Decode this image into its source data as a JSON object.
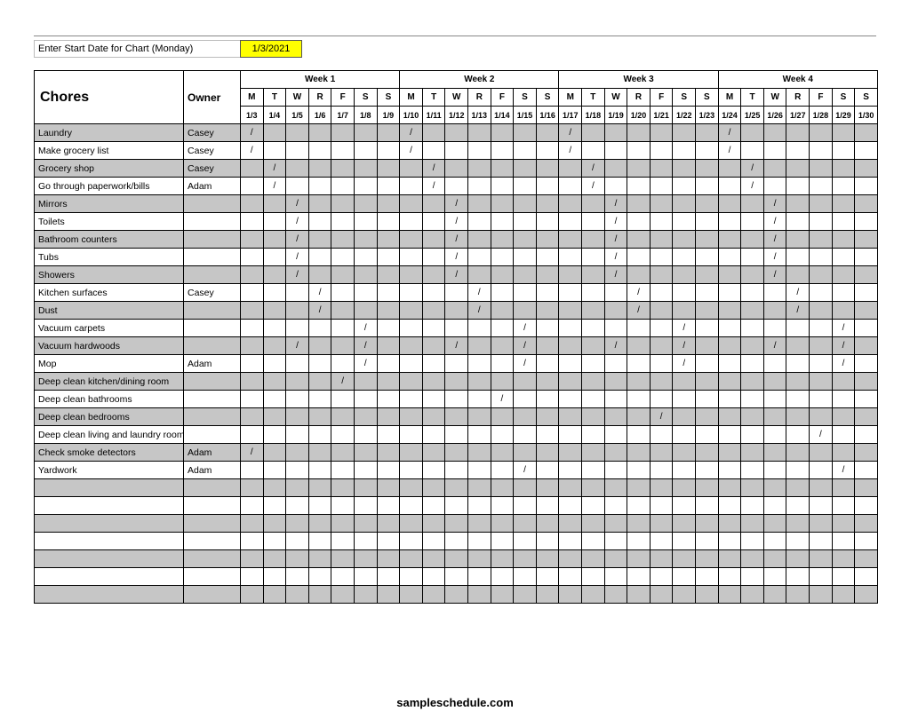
{
  "start_date_label": "Enter Start Date for Chart (Monday)",
  "start_date": "1/3/2021",
  "header": {
    "chores": "Chores",
    "owner": "Owner",
    "weeks": [
      "Week 1",
      "Week 2",
      "Week 3",
      "Week 4"
    ],
    "days": [
      "M",
      "T",
      "W",
      "R",
      "F",
      "S",
      "S"
    ],
    "dates": [
      "1/3",
      "1/4",
      "1/5",
      "1/6",
      "1/7",
      "1/8",
      "1/9",
      "1/10",
      "1/11",
      "1/12",
      "1/13",
      "1/14",
      "1/15",
      "1/16",
      "1/17",
      "1/18",
      "1/19",
      "1/20",
      "1/21",
      "1/22",
      "1/23",
      "1/24",
      "1/25",
      "1/26",
      "1/27",
      "1/28",
      "1/29",
      "1/30"
    ]
  },
  "rows": [
    {
      "chore": "Laundry",
      "owner": "Casey",
      "marks": [
        0,
        7,
        14,
        21
      ]
    },
    {
      "chore": "Make grocery list",
      "owner": "Casey",
      "marks": [
        0,
        7,
        14,
        21
      ]
    },
    {
      "chore": "Grocery shop",
      "owner": "Casey",
      "marks": [
        1,
        8,
        15,
        22
      ]
    },
    {
      "chore": "Go through paperwork/bills",
      "owner": "Adam",
      "marks": [
        1,
        8,
        15,
        22
      ]
    },
    {
      "chore": "Mirrors",
      "owner": "",
      "marks": [
        2,
        9,
        16,
        23
      ]
    },
    {
      "chore": "Toilets",
      "owner": "",
      "marks": [
        2,
        9,
        16,
        23
      ]
    },
    {
      "chore": "Bathroom counters",
      "owner": "",
      "marks": [
        2,
        9,
        16,
        23
      ]
    },
    {
      "chore": "Tubs",
      "owner": "",
      "marks": [
        2,
        9,
        16,
        23
      ]
    },
    {
      "chore": "Showers",
      "owner": "",
      "marks": [
        2,
        9,
        16,
        23
      ]
    },
    {
      "chore": "Kitchen surfaces",
      "owner": "Casey",
      "marks": [
        3,
        10,
        17,
        24
      ]
    },
    {
      "chore": "Dust",
      "owner": "",
      "marks": [
        3,
        10,
        17,
        24
      ]
    },
    {
      "chore": "Vacuum carpets",
      "owner": "",
      "marks": [
        5,
        12,
        19,
        26
      ]
    },
    {
      "chore": "Vacuum hardwoods",
      "owner": "",
      "marks": [
        2,
        5,
        9,
        12,
        16,
        19,
        23,
        26
      ]
    },
    {
      "chore": "Mop",
      "owner": "Adam",
      "marks": [
        5,
        12,
        19,
        26
      ]
    },
    {
      "chore": "Deep clean kitchen/dining room",
      "owner": "",
      "marks": [
        4
      ]
    },
    {
      "chore": "Deep clean bathrooms",
      "owner": "",
      "marks": [
        11
      ]
    },
    {
      "chore": "Deep clean bedrooms",
      "owner": "",
      "marks": [
        18
      ]
    },
    {
      "chore": "Deep clean living and laundry rooms",
      "owner": "",
      "marks": [
        25
      ]
    },
    {
      "chore": "Check smoke detectors",
      "owner": "Adam",
      "marks": [
        0
      ]
    },
    {
      "chore": "Yardwork",
      "owner": "Adam",
      "marks": [
        12,
        26
      ]
    },
    {
      "chore": "",
      "owner": "",
      "marks": []
    },
    {
      "chore": "",
      "owner": "",
      "marks": []
    },
    {
      "chore": "",
      "owner": "",
      "marks": []
    },
    {
      "chore": "",
      "owner": "",
      "marks": []
    },
    {
      "chore": "",
      "owner": "",
      "marks": []
    },
    {
      "chore": "",
      "owner": "",
      "marks": []
    },
    {
      "chore": "",
      "owner": "",
      "marks": []
    }
  ],
  "mark_symbol": "/",
  "footer": "sampleschedule.com"
}
